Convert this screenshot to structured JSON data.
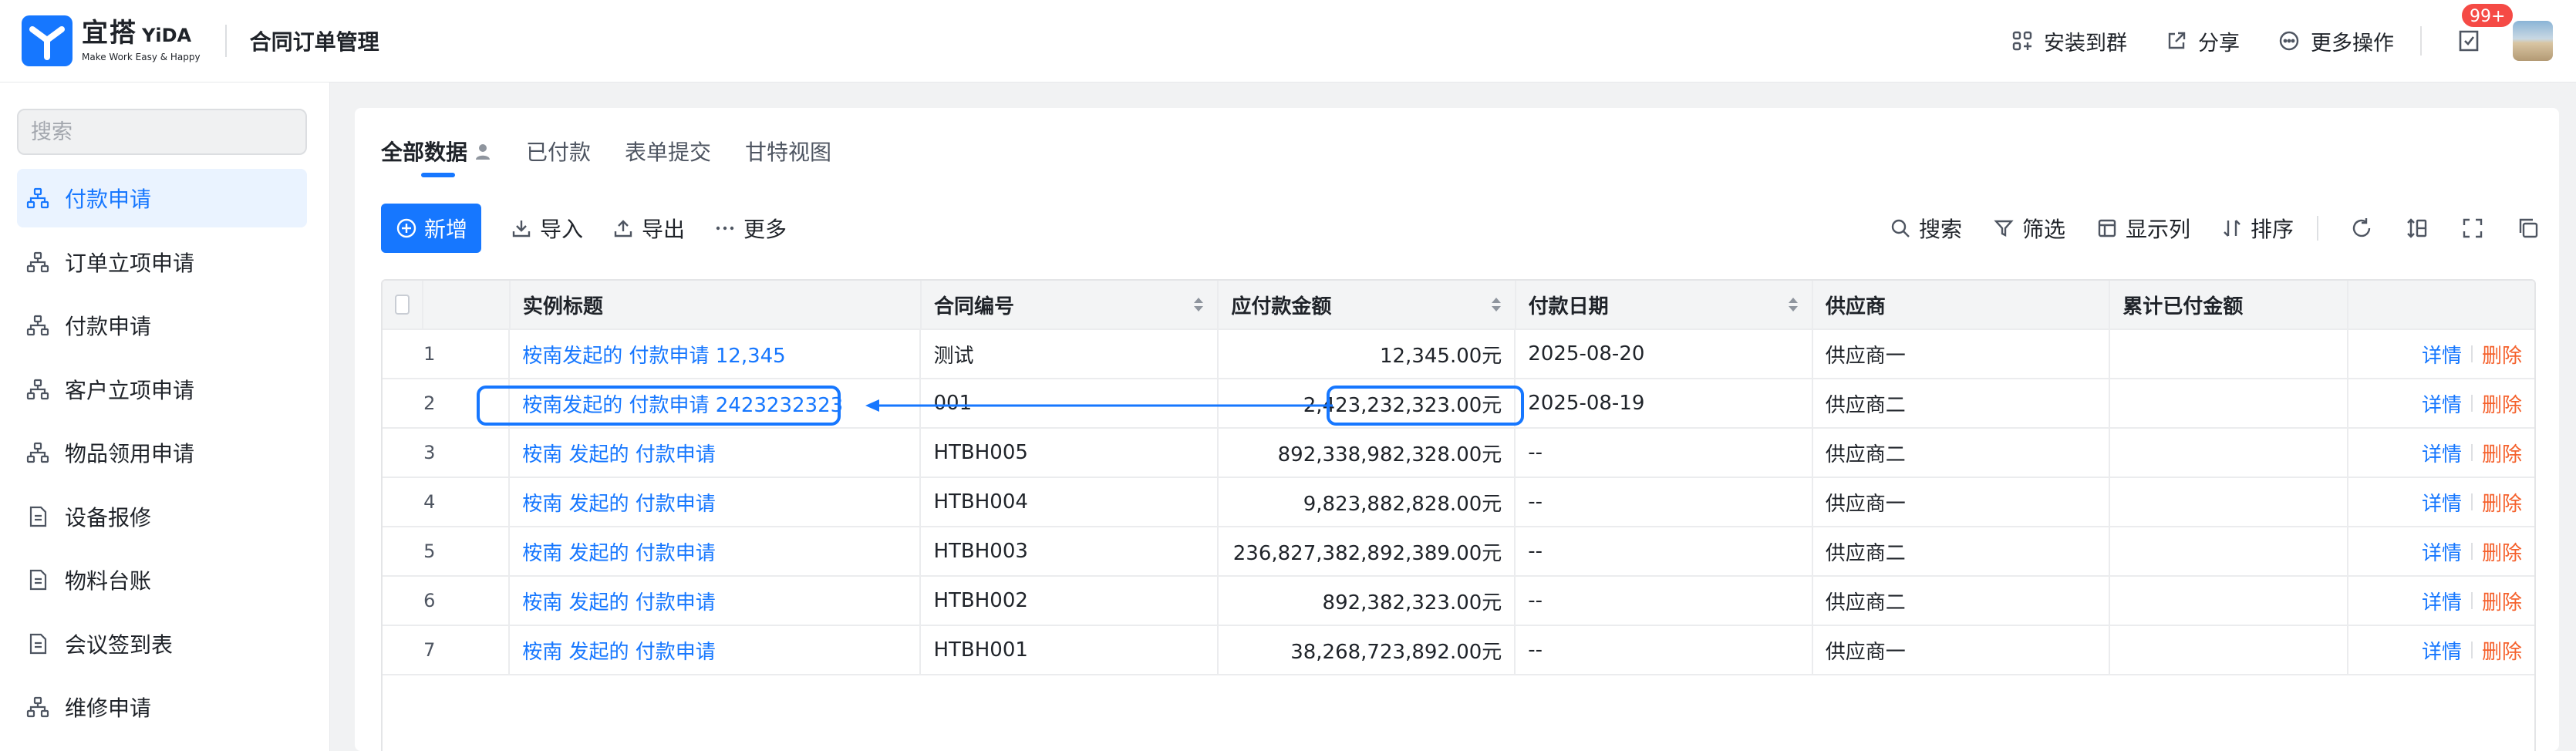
{
  "header": {
    "logo_name": "宜搭",
    "logo_name_en": "YiDA",
    "logo_slogan": "Make Work Easy & Happy",
    "app_title": "合同订单管理",
    "actions": [
      {
        "label": "安装到群",
        "icon": "grid-plus-icon"
      },
      {
        "label": "分享",
        "icon": "share-icon"
      },
      {
        "label": "更多操作",
        "icon": "more-circle-icon"
      }
    ],
    "todo_badge": "99+"
  },
  "sidebar": {
    "search_placeholder": "搜索",
    "items": [
      {
        "label": "付款申请",
        "icon": "flow-icon",
        "active": true
      },
      {
        "label": "订单立项申请",
        "icon": "flow-icon"
      },
      {
        "label": "付款申请",
        "icon": "flow-icon"
      },
      {
        "label": "客户立项申请",
        "icon": "flow-icon"
      },
      {
        "label": "物品领用申请",
        "icon": "flow-icon"
      },
      {
        "label": "设备报修",
        "icon": "form-icon"
      },
      {
        "label": "物料台账",
        "icon": "form-icon"
      },
      {
        "label": "会议签到表",
        "icon": "form-icon"
      },
      {
        "label": "维修申请",
        "icon": "flow-icon"
      }
    ]
  },
  "main": {
    "tabs": [
      {
        "label": "全部数据",
        "active": true
      },
      {
        "label": "已付款"
      },
      {
        "label": "表单提交"
      },
      {
        "label": "甘特视图"
      }
    ],
    "toolbar": {
      "add_label": "新增",
      "import_label": "导入",
      "export_label": "导出",
      "more_label": "更多",
      "search_label": "搜索",
      "filter_label": "筛选",
      "columns_label": "显示列",
      "sort_label": "排序"
    },
    "table": {
      "columns": [
        "实例标题",
        "合同编号",
        "应付款金额",
        "付款日期",
        "供应商",
        "累计已付金额"
      ],
      "detail_label": "详情",
      "delete_label": "删除",
      "rows": [
        {
          "idx": "1",
          "title": "桉南发起的 付款申请 12,345",
          "contract_no": "测试",
          "amount": "12,345.00元",
          "date": "2025-08-20",
          "supplier": "供应商一",
          "paid": ""
        },
        {
          "idx": "2",
          "title": "桉南发起的 付款申请 2423232323",
          "contract_no": "001",
          "amount": "2,423,232,323.00元",
          "date": "2025-08-19",
          "supplier": "供应商二",
          "paid": ""
        },
        {
          "idx": "3",
          "title": "桉南 发起的 付款申请",
          "contract_no": "HTBH005",
          "amount": "892,338,982,328.00元",
          "date": "--",
          "supplier": "供应商二",
          "paid": ""
        },
        {
          "idx": "4",
          "title": "桉南 发起的 付款申请",
          "contract_no": "HTBH004",
          "amount": "9,823,882,828.00元",
          "date": "--",
          "supplier": "供应商一",
          "paid": ""
        },
        {
          "idx": "5",
          "title": "桉南 发起的 付款申请",
          "contract_no": "HTBH003",
          "amount": "236,827,382,892,389.00元",
          "date": "--",
          "supplier": "供应商二",
          "paid": ""
        },
        {
          "idx": "6",
          "title": "桉南 发起的 付款申请",
          "contract_no": "HTBH002",
          "amount": "892,382,323.00元",
          "date": "--",
          "supplier": "供应商二",
          "paid": ""
        },
        {
          "idx": "7",
          "title": "桉南 发起的 付款申请",
          "contract_no": "HTBH001",
          "amount": "38,268,723,892.00元",
          "date": "--",
          "supplier": "供应商一",
          "paid": ""
        }
      ]
    }
  },
  "colors": {
    "accent": "#1677ff",
    "danger": "#f5612c",
    "badge": "#f54a45"
  }
}
